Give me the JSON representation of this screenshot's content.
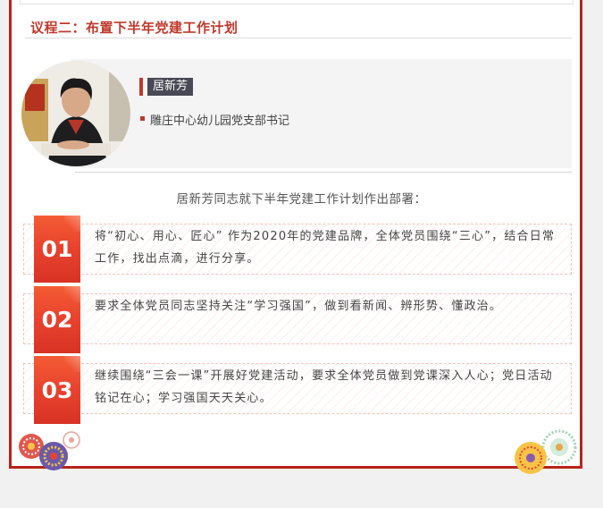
{
  "section": {
    "agenda_title": "议程二：布置下半年党建工作计划"
  },
  "profile": {
    "name": "居新芳",
    "position": "雕庄中心幼儿园党支部书记"
  },
  "intro": "居新芳同志就下半年党建工作计划作出部署：",
  "items": [
    {
      "number": "01",
      "text": "将“初心、用心、匠心” 作为2020年的党建品牌，全体党员围绕“三心”，结合日常工作，找出点滴，进行分享。"
    },
    {
      "number": "02",
      "text": "要求全体党员同志坚持关注“学习强国”，做到看新闻、辨形势、懂政治。"
    },
    {
      "number": "03",
      "text": "继续围绕“三会一课”开展好党建活动，要求全体党员做到党课深入人心；党日活动铭记在心；学习强国天天关心。"
    }
  ],
  "colors": {
    "accent": "#b8231b",
    "number_block": "#e8422e",
    "name_tag": "#4a4a56"
  }
}
